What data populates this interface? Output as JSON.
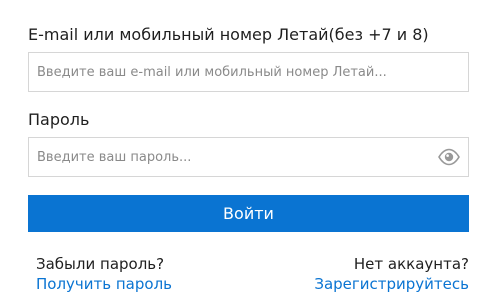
{
  "form": {
    "email": {
      "label": "E-mail или мобильный номер Летай(без +7 и 8)",
      "value": "",
      "placeholder": "Введите ваш e-mail или мобильный номер Летай..."
    },
    "password": {
      "label": "Пароль",
      "value": "",
      "placeholder": "Введите ваш пароль...",
      "toggle_icon": "eye-icon"
    },
    "submit_label": "Войти"
  },
  "footer": {
    "forgot": {
      "text": "Забыли пароль?",
      "link": "Получить пароль"
    },
    "register": {
      "text": "Нет аккаунта?",
      "link": "Зарегистрируйтесь"
    }
  },
  "colors": {
    "accent": "#0a74d2",
    "border": "#d6d6d6",
    "text": "#1f1f1f",
    "placeholder": "#8a8a8a",
    "icon": "#999999"
  }
}
